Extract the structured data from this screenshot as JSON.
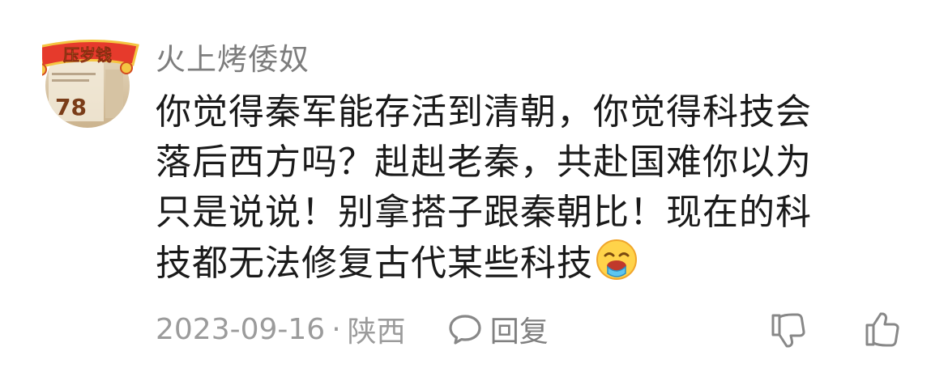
{
  "comment": {
    "username": "火上烤倭奴",
    "avatar": {
      "badge_text": "压岁钱",
      "number": "78",
      "icon": "lucky-money-avatar"
    },
    "content_lines": [
      "你觉得秦军能存活到清朝，你觉得科技会",
      "落后西方吗？赳赳老秦，共赴国难你以为",
      "只是说说！别拿搭子跟秦朝比！现在的科",
      "技都无法修复古代某些科技"
    ],
    "emoji": "drooling-face-emoji",
    "date": "2023-09-16",
    "separator": "·",
    "location": "陕西",
    "reply_label": "回复",
    "icons": {
      "reply": "comment-icon",
      "dislike": "thumbs-down-icon",
      "like": "thumbs-up-icon"
    },
    "colors": {
      "username": "#7d7d7d",
      "text": "#1a1a1a",
      "meta": "#9b9b9b"
    }
  }
}
